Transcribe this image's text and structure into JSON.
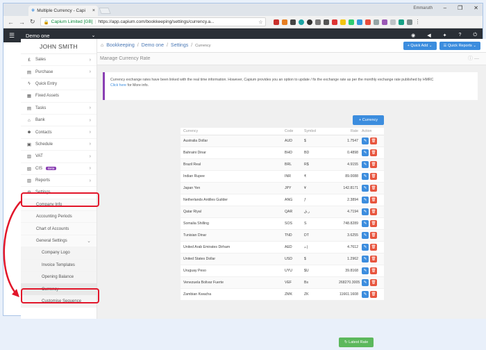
{
  "browser": {
    "tab_title": "Multiple Currency - Capi",
    "url_org": "Capium Limited [GB]",
    "url": "https://app.capium.com/bookkeeping/settings/currency.a...",
    "profile": "Emmaruth"
  },
  "header": {
    "company": "Demo one"
  },
  "sidebar": {
    "user": "JOHN SMITH",
    "items": [
      {
        "label": "Sales",
        "icon": "pound-icon",
        "glyph": "£"
      },
      {
        "label": "Purchase",
        "icon": "cart-icon",
        "glyph": "▤"
      },
      {
        "label": "Quick Entry",
        "icon": "bolt-icon",
        "glyph": "ϟ"
      },
      {
        "label": "Fixed Assets",
        "icon": "assets-icon",
        "glyph": "▦"
      },
      {
        "label": "Tasks",
        "icon": "tasks-icon",
        "glyph": "▤"
      },
      {
        "label": "Bank",
        "icon": "bank-icon",
        "glyph": "⌂"
      },
      {
        "label": "Contacts",
        "icon": "contacts-icon",
        "glyph": "☻"
      },
      {
        "label": "Schedule",
        "icon": "calendar-icon",
        "glyph": "▣"
      },
      {
        "label": "VAT",
        "icon": "vat-icon",
        "glyph": "▥"
      },
      {
        "label": "CIS",
        "icon": "cis-icon",
        "glyph": "▧",
        "badge": "Beta"
      },
      {
        "label": "Reports",
        "icon": "reports-icon",
        "glyph": "▥"
      },
      {
        "label": "Settings",
        "icon": "settings-icon",
        "glyph": "⚙"
      }
    ],
    "settings_sub": [
      {
        "label": "Company Info"
      },
      {
        "label": "Accounting Periods"
      },
      {
        "label": "Chart of Accounts"
      },
      {
        "label": "General Settings"
      }
    ],
    "general_sub": [
      {
        "label": "Company Logo"
      },
      {
        "label": "Invoice Templates"
      },
      {
        "label": "Opening Balance"
      },
      {
        "label": "Currency"
      },
      {
        "label": "Customise Sequence"
      }
    ]
  },
  "breadcrumb": {
    "items": [
      "Bookkeeping",
      "Demo one",
      "Settings"
    ],
    "current": "Currency"
  },
  "buttons": {
    "quick_add": "Quick Add",
    "quick_reports": "Quick Reports",
    "add_currency": "Currency",
    "latest_rate": "Latest Rate"
  },
  "page": {
    "title": "Manage Currency Rate",
    "notice": "Currency exchange rates have been linked with the real time information. However, Capium provides you an option to update / fix the exchange rate as per the monthly exchange rate published by HMRC",
    "notice_link": "Click here",
    "notice_tail": "for More info."
  },
  "table": {
    "headers": [
      "Currency",
      "Code",
      "Symbol",
      "Rate",
      "Action"
    ],
    "rows": [
      [
        "Australia Dollar",
        "AUD",
        "$",
        "1.7547"
      ],
      [
        "Bahraini Dinar",
        "BHD",
        "BD",
        "0.4898"
      ],
      [
        "Brazil Real",
        "BRL",
        "R$",
        "4.9155"
      ],
      [
        "Indian Rupee",
        "INR",
        "₹",
        "89.0088"
      ],
      [
        "Japan Yen",
        "JPY",
        "¥",
        "142.8171"
      ],
      [
        "Netherlands Antilles Guilder",
        "ANG",
        "ƒ",
        "2.3894"
      ],
      [
        "Qatar Riyal",
        "QAR",
        "ر.ق",
        "4.7194"
      ],
      [
        "Somalia Shilling",
        "SOS",
        "S",
        "748.8289"
      ],
      [
        "Tunisian Dinar",
        "TND",
        "DT",
        "3.6255"
      ],
      [
        "United Arab Emirates Dirham",
        "AED",
        "إ.د",
        "4.7612"
      ],
      [
        "United States Dollar",
        "USD",
        "$",
        "1.2962"
      ],
      [
        "Uruguay Peso",
        "UYU",
        "$U",
        "39.8168"
      ],
      [
        "Venezuela Bolivar Fuerte",
        "VEF",
        "Bs",
        "268270.3005"
      ],
      [
        "Zambian Kwacha",
        "ZMK",
        "ZK",
        "11661.1608"
      ]
    ]
  },
  "colors": {
    "accent": "#3c8dde",
    "delete": "#e8553e",
    "highlight": "#e2162a",
    "notice_border": "#8a3fb3"
  }
}
